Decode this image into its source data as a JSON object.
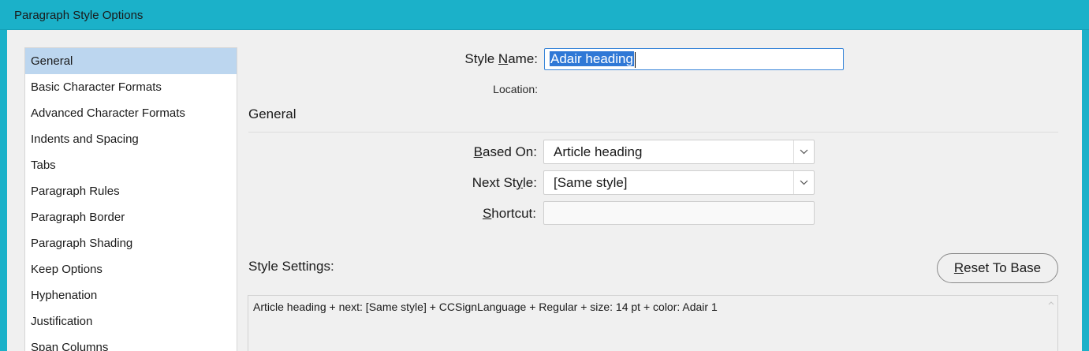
{
  "window": {
    "title": "Paragraph Style Options"
  },
  "sidebar": {
    "items": [
      {
        "label": "General",
        "selected": true
      },
      {
        "label": "Basic Character Formats"
      },
      {
        "label": "Advanced Character Formats"
      },
      {
        "label": "Indents and Spacing"
      },
      {
        "label": "Tabs"
      },
      {
        "label": "Paragraph Rules"
      },
      {
        "label": "Paragraph Border"
      },
      {
        "label": "Paragraph Shading"
      },
      {
        "label": "Keep Options"
      },
      {
        "label": "Hyphenation"
      },
      {
        "label": "Justification"
      },
      {
        "label": "Span Columns"
      }
    ]
  },
  "style_name": {
    "label_pre": "Style ",
    "label_mnemonic": "N",
    "label_post": "ame:",
    "value": "Adair heading"
  },
  "location": {
    "label": "Location:",
    "value": ""
  },
  "general_section": {
    "heading": "General"
  },
  "based_on": {
    "label_mnemonic": "B",
    "label_post": "ased On:",
    "value": "Article heading"
  },
  "next_style": {
    "label_pre": "Next St",
    "label_mnemonic": "y",
    "label_post": "le:",
    "value": "[Same style]"
  },
  "shortcut": {
    "label_mnemonic": "S",
    "label_post": "hortcut:",
    "value": ""
  },
  "style_settings": {
    "label": "Style Settings:",
    "text": "Article heading + next: [Same style] + CCSignLanguage + Regular + size: 14 pt + color: Adair 1"
  },
  "reset_button": {
    "label_mnemonic": "R",
    "label_post": "eset To Base"
  },
  "colors": {
    "titlebar": "#1bb1c9",
    "selection": "#bcd6ef",
    "focus_border": "#3b87d9"
  }
}
